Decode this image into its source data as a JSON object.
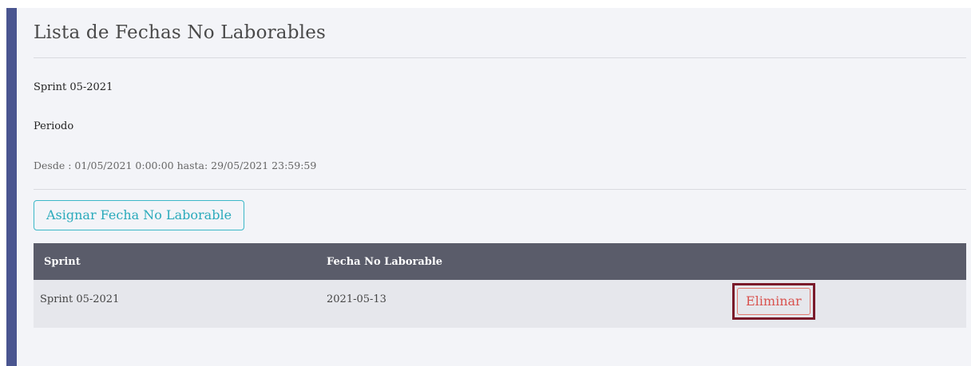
{
  "page": {
    "title": "Lista de Fechas No Laborables",
    "sprint_name": "Sprint 05-2021",
    "period_label": "Periodo",
    "date_range": "Desde : 01/05/2021 0:00:00 hasta: 29/05/2021 23:59:59"
  },
  "actions": {
    "assign_label": "Asignar Fecha No Laborable"
  },
  "table": {
    "headers": [
      "Sprint",
      "Fecha No Laborable",
      ""
    ],
    "rows": [
      {
        "sprint": "Sprint 05-2021",
        "fecha": "2021-05-13",
        "action_label": "Eliminar"
      }
    ]
  },
  "colors": {
    "sidebar_accent": "#4a5590",
    "header_bg": "#5a5c6a",
    "info_button": "#2aaabb",
    "danger_button": "#d9534f",
    "highlight_border": "#7a1a2a"
  }
}
